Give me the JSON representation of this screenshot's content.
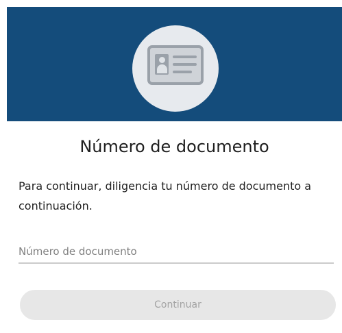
{
  "header": {
    "icon": "id-card-icon",
    "background_color": "#144c7b"
  },
  "main": {
    "title": "Número de documento",
    "description": "Para continuar, diligencia tu número de documento a continuación.",
    "document_field": {
      "value": "",
      "placeholder": "Número de documento"
    },
    "continue_button": {
      "label": "Continuar",
      "state": "disabled"
    }
  }
}
